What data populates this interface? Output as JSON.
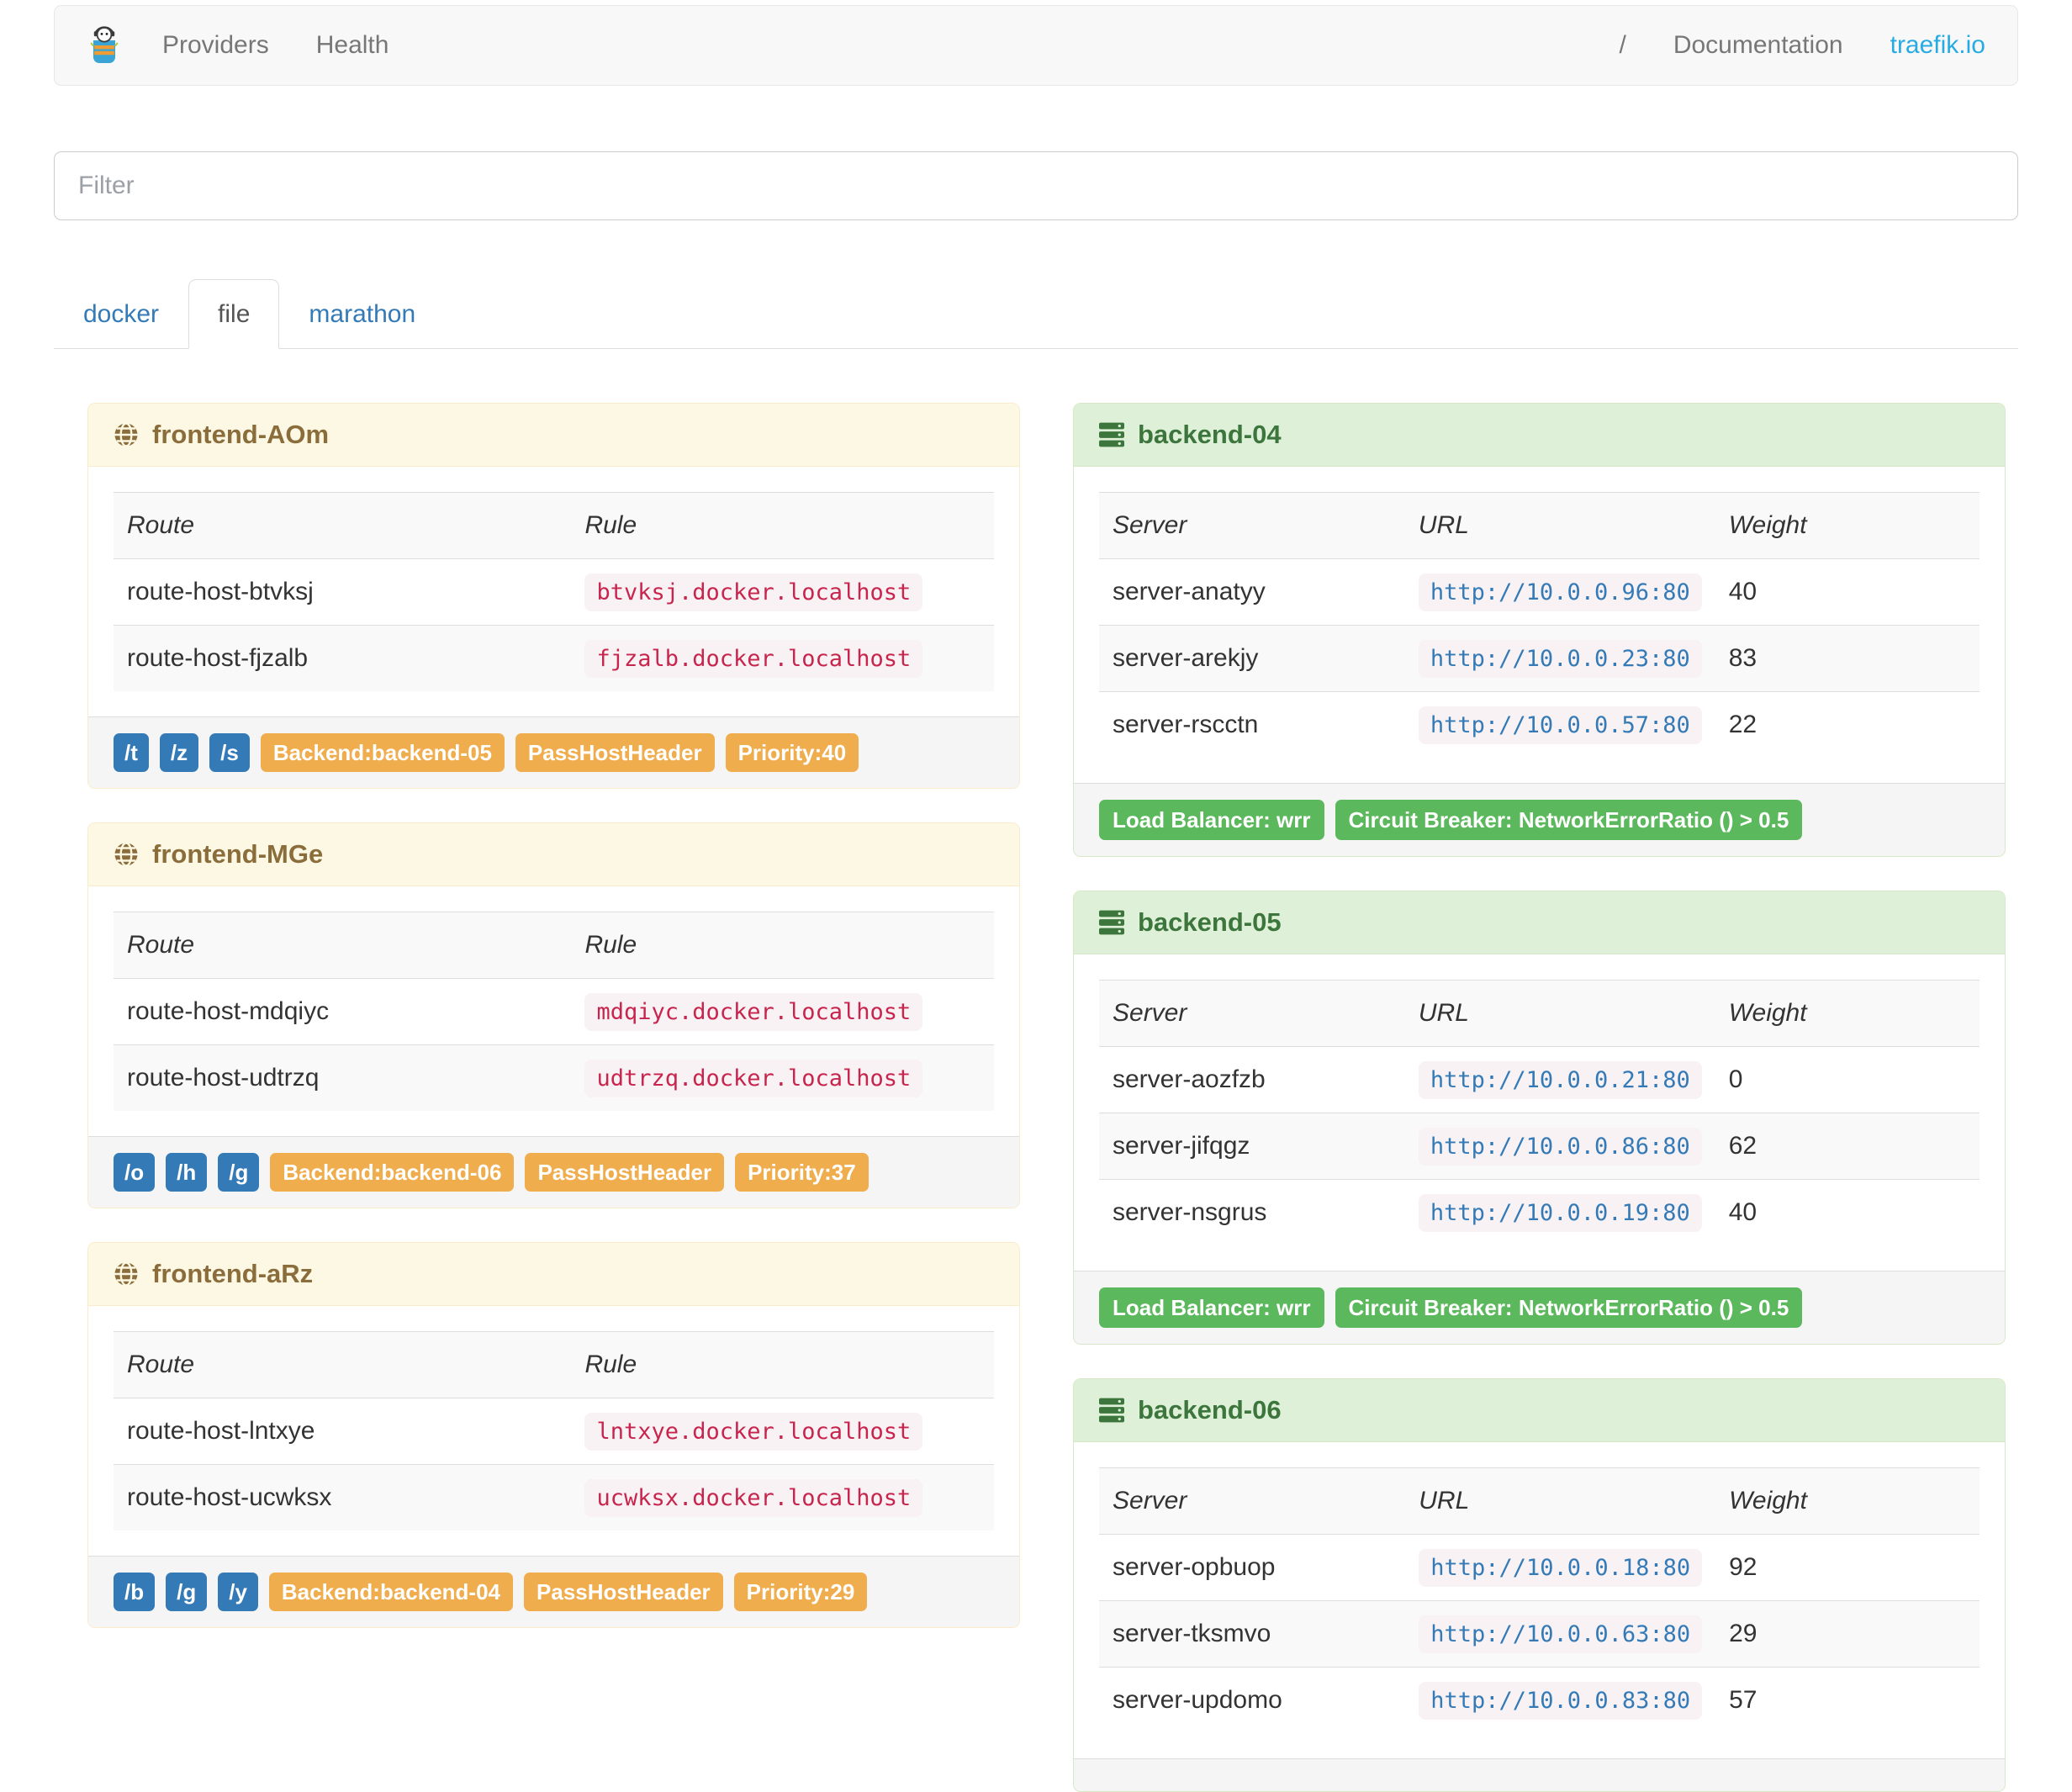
{
  "navbar": {
    "links": [
      {
        "label": "Providers"
      },
      {
        "label": "Health"
      }
    ],
    "right_links": [
      {
        "label": "/"
      },
      {
        "label": "Documentation"
      },
      {
        "label": "traefik.io"
      }
    ]
  },
  "filter": {
    "placeholder": "Filter",
    "value": ""
  },
  "tabs": [
    {
      "label": "docker",
      "active": false
    },
    {
      "label": "file",
      "active": true
    },
    {
      "label": "marathon",
      "active": false
    }
  ],
  "frontend_table": {
    "headers": [
      "Route",
      "Rule"
    ]
  },
  "backend_table": {
    "headers": [
      "Server",
      "URL",
      "Weight"
    ]
  },
  "frontends": [
    {
      "title": "frontend-AOm",
      "routes": [
        {
          "route": "route-host-btvksj",
          "rule": "btvksj.docker.localhost"
        },
        {
          "route": "route-host-fjzalb",
          "rule": "fjzalb.docker.localhost"
        }
      ],
      "path_tags": [
        "/t",
        "/z",
        "/s"
      ],
      "badges": [
        "Backend:backend-05",
        "PassHostHeader",
        "Priority:40"
      ]
    },
    {
      "title": "frontend-MGe",
      "routes": [
        {
          "route": "route-host-mdqiyc",
          "rule": "mdqiyc.docker.localhost"
        },
        {
          "route": "route-host-udtrzq",
          "rule": "udtrzq.docker.localhost"
        }
      ],
      "path_tags": [
        "/o",
        "/h",
        "/g"
      ],
      "badges": [
        "Backend:backend-06",
        "PassHostHeader",
        "Priority:37"
      ]
    },
    {
      "title": "frontend-aRz",
      "routes": [
        {
          "route": "route-host-lntxye",
          "rule": "lntxye.docker.localhost"
        },
        {
          "route": "route-host-ucwksx",
          "rule": "ucwksx.docker.localhost"
        }
      ],
      "path_tags": [
        "/b",
        "/g",
        "/y"
      ],
      "badges": [
        "Backend:backend-04",
        "PassHostHeader",
        "Priority:29"
      ]
    }
  ],
  "backends": [
    {
      "title": "backend-04",
      "servers": [
        {
          "server": "server-anatyy",
          "url": "http://10.0.0.96:80",
          "weight": "40"
        },
        {
          "server": "server-arekjy",
          "url": "http://10.0.0.23:80",
          "weight": "83"
        },
        {
          "server": "server-rscctn",
          "url": "http://10.0.0.57:80",
          "weight": "22"
        }
      ],
      "badges": [
        "Load Balancer: wrr",
        "Circuit Breaker: NetworkErrorRatio () > 0.5"
      ]
    },
    {
      "title": "backend-05",
      "servers": [
        {
          "server": "server-aozfzb",
          "url": "http://10.0.0.21:80",
          "weight": "0"
        },
        {
          "server": "server-jifqgz",
          "url": "http://10.0.0.86:80",
          "weight": "62"
        },
        {
          "server": "server-nsgrus",
          "url": "http://10.0.0.19:80",
          "weight": "40"
        }
      ],
      "badges": [
        "Load Balancer: wrr",
        "Circuit Breaker: NetworkErrorRatio () > 0.5"
      ]
    },
    {
      "title": "backend-06",
      "servers": [
        {
          "server": "server-opbuop",
          "url": "http://10.0.0.18:80",
          "weight": "92"
        },
        {
          "server": "server-tksmvo",
          "url": "http://10.0.0.63:80",
          "weight": "29"
        },
        {
          "server": "server-updomo",
          "url": "http://10.0.0.83:80",
          "weight": "57"
        }
      ],
      "badges": []
    }
  ],
  "colors": {
    "accent_blue": "#337ab7",
    "warning_orange": "#f0ad4e",
    "success_green": "#5cb85c",
    "frontend_header_bg": "#fcf8e3",
    "frontend_header_text": "#8a6d3b",
    "backend_header_bg": "#dff0d8",
    "backend_header_text": "#3c763d",
    "code_text": "#c7254e",
    "code_url_text": "#337ab7",
    "code_bg": "#f9f2f4",
    "traefik_link": "#28abe3"
  },
  "icons": {
    "frontend": "globe-icon",
    "backend": "server-stack-icon",
    "brand": "traefik-logo"
  }
}
